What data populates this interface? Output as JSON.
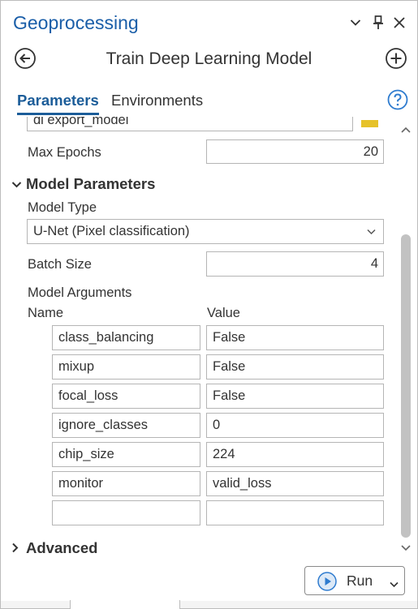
{
  "pane": {
    "title": "Geoprocessing",
    "accent_color": "#1a5ea8"
  },
  "header_controls": {
    "options_icon": "chevron-down-icon",
    "pin_icon": "pin-icon",
    "close_icon": "close-icon"
  },
  "tool": {
    "title": "Train Deep Learning Model",
    "back_icon": "back-arrow-icon",
    "add_icon": "plus-circle-icon"
  },
  "tabs": [
    {
      "label": "Parameters",
      "active": true
    },
    {
      "label": "Environments",
      "active": false
    }
  ],
  "help_icon": "help-icon",
  "partial_field": {
    "value": "dl export_model",
    "browse_icon": "folder-icon"
  },
  "max_epochs": {
    "label": "Max Epochs",
    "value": "20"
  },
  "model_parameters": {
    "header": "Model Parameters",
    "expanded": true,
    "model_type_label": "Model Type",
    "model_type_value": "U-Net (Pixel classification)",
    "batch_size_label": "Batch Size",
    "batch_size_value": "4",
    "model_arguments_label": "Model Arguments",
    "columns": [
      "Name",
      "Value"
    ],
    "arguments": [
      {
        "name": "class_balancing",
        "value": "False"
      },
      {
        "name": "mixup",
        "value": "False"
      },
      {
        "name": "focal_loss",
        "value": "False"
      },
      {
        "name": "ignore_classes",
        "value": "0"
      },
      {
        "name": "chip_size",
        "value": "224"
      },
      {
        "name": "monitor",
        "value": "valid_loss"
      },
      {
        "name": "",
        "value": ""
      }
    ]
  },
  "advanced": {
    "header": "Advanced",
    "expanded": false
  },
  "run": {
    "label": "Run",
    "icon": "play-icon",
    "dropdown_icon": "chevron-down-icon",
    "color": "#2e7bcf"
  }
}
